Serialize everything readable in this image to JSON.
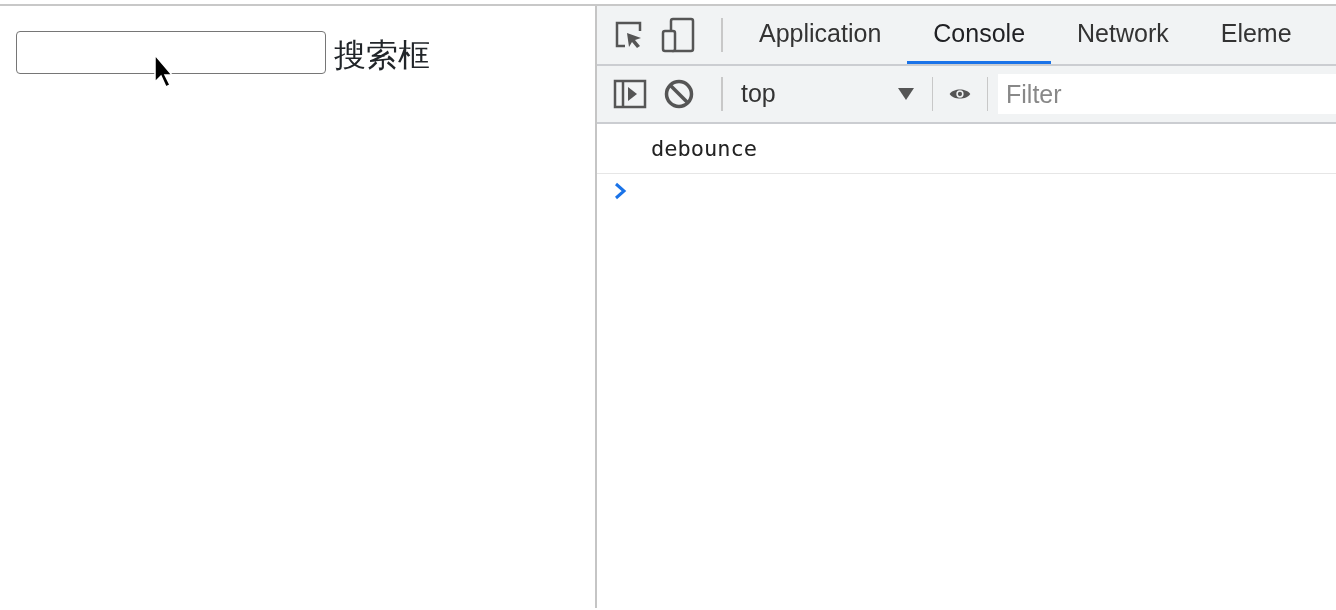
{
  "page": {
    "search_field": {
      "label": "搜索框"
    }
  },
  "devtools": {
    "tabs": [
      {
        "label": "Application",
        "selected": false
      },
      {
        "label": "Console",
        "selected": true
      },
      {
        "label": "Network",
        "selected": false
      },
      {
        "label": "Eleme",
        "selected": false
      }
    ],
    "console_toolbar": {
      "context": "top",
      "filter": {
        "placeholder": "Filter"
      }
    },
    "messages": [
      "debounce"
    ]
  }
}
